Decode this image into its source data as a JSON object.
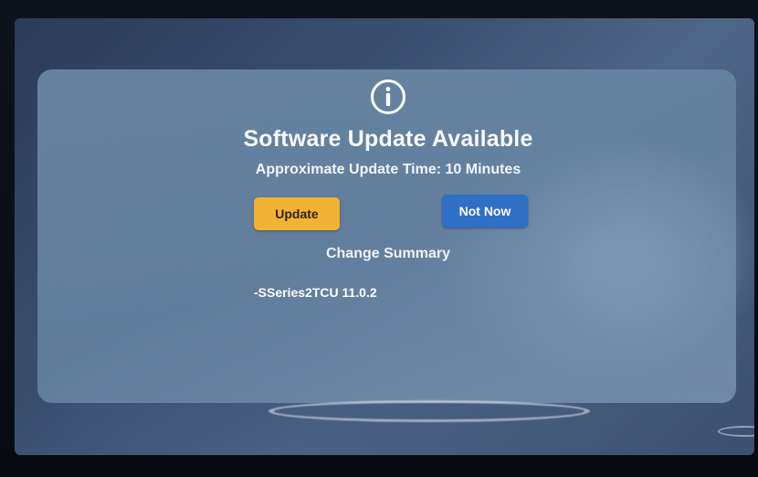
{
  "dialog": {
    "icon": "info-circle-icon",
    "title": "Software Update Available",
    "subtitle": "Approximate Update Time: 10 Minutes",
    "buttons": {
      "update_label": "Update",
      "not_now_label": "Not Now"
    },
    "summary": {
      "heading": "Change Summary",
      "items": [
        "-SSeries2TCU 11.0.2"
      ]
    }
  },
  "colors": {
    "update_button": "#f2b233",
    "not_now_button": "#2f6fc6",
    "text": "#f7f9fc"
  }
}
